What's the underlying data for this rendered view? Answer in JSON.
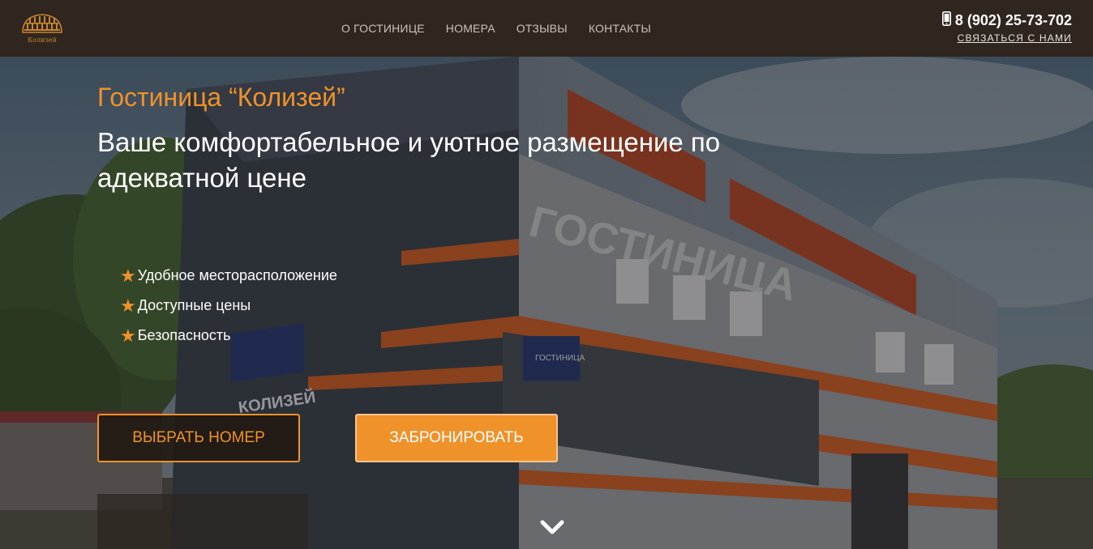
{
  "header": {
    "logo_text": "Колизей",
    "nav": [
      {
        "label": "О ГОСТИНИЦЕ"
      },
      {
        "label": "НОМЕРА"
      },
      {
        "label": "ОТЗЫВЫ"
      },
      {
        "label": "КОНТАКТЫ"
      }
    ],
    "phone": "8 (902) 25-73-702",
    "contact_link": "СВЯЗАТЬСЯ С НАМИ"
  },
  "hero": {
    "title": "Гостиница “Колизей”",
    "subtitle": "Ваше комфортабельное и уютное размещение по адекватной цене",
    "features": [
      {
        "label": "Удобное месторасположение"
      },
      {
        "label": "Доступные цены"
      },
      {
        "label": "Безопасность"
      }
    ],
    "choose_room_label": "ВЫБРАТЬ НОМЕР",
    "book_label": "ЗАБРОНИРОВАТЬ",
    "building_sign": "ГОСТИНИЦА",
    "signboard_top": "ГОСТИНИЦА",
    "signboard_name": "КОЛИЗЕЙ"
  },
  "icons": {
    "logo": "colosseum-logo-icon",
    "phone": "phone-icon",
    "feature": "star-icon",
    "scroll": "chevron-down-icon"
  },
  "colors": {
    "accent": "#f0922a",
    "header_bg": "#2f2620",
    "nav_text": "#c9c2ba"
  }
}
